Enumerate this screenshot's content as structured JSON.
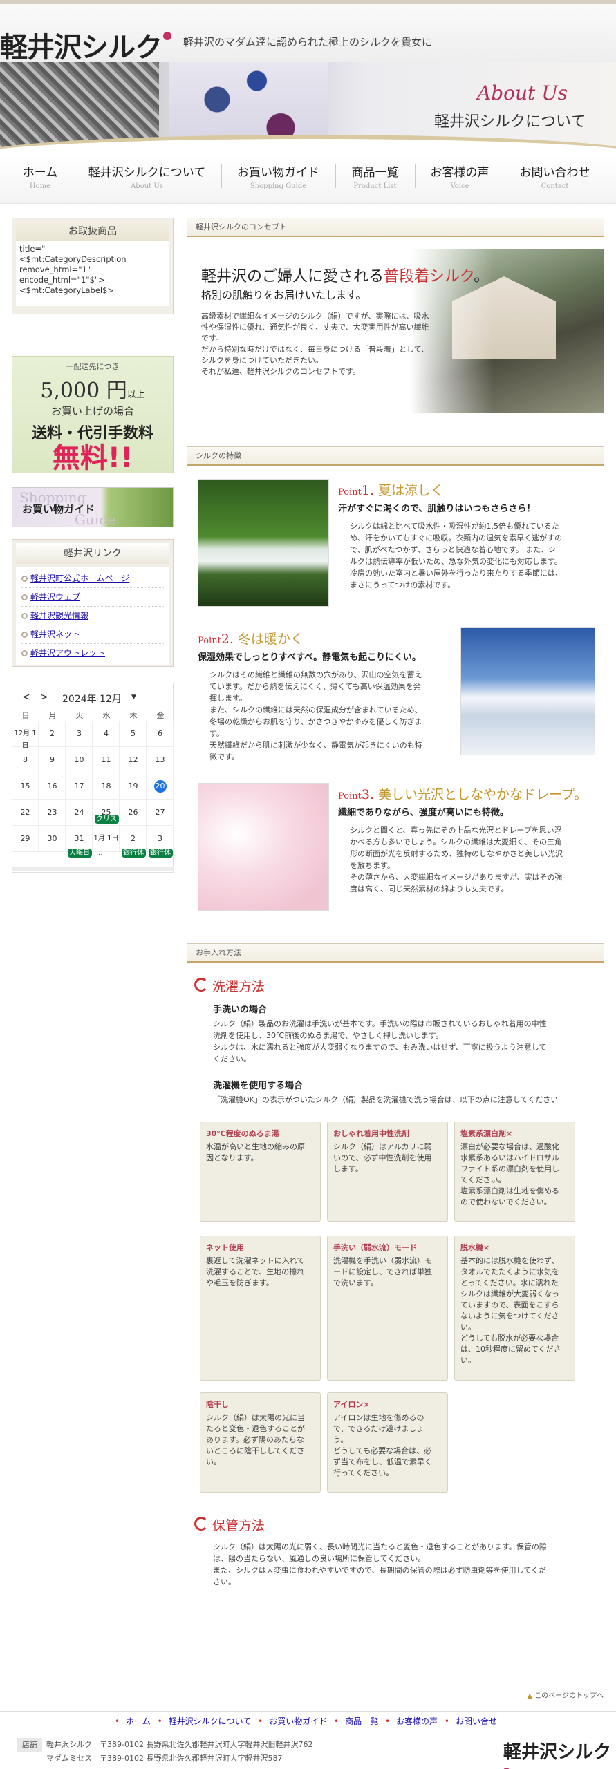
{
  "header": {
    "logo": "軽井沢シルク",
    "tagline": "軽井沢のマダム達に認められた極上のシルクを貴女に"
  },
  "banner": {
    "script": "About Us",
    "title": "軽井沢シルクについて"
  },
  "gnav": [
    {
      "jp": "ホーム",
      "en": "Home"
    },
    {
      "jp": "軽井沢シルクについて",
      "en": "About Us"
    },
    {
      "jp": "お買い物ガイド",
      "en": "Shopping Guide"
    },
    {
      "jp": "商品一覧",
      "en": "Product List"
    },
    {
      "jp": "お客様の声",
      "en": "Voice"
    },
    {
      "jp": "お問い合わせ",
      "en": "Contact"
    }
  ],
  "sidebar": {
    "category_title": "お取扱商品",
    "category_text": "title=\"\n<$mt:CategoryDescription remove_html=\"1\" encode_html=\"1\"$\">\n<$mt:CategoryLabel$>",
    "shipping": {
      "line1": "一配送先につき",
      "amount": "5,000 円",
      "amount_suffix": "以上",
      "line2": "お買い上げの場合",
      "line3": "送料・代引手数料",
      "line4": "無料!!"
    },
    "guide": {
      "en1": "Shopping",
      "jp": "お買い物ガイド",
      "en2": "Guide"
    },
    "links_title": "軽井沢リンク",
    "links": [
      "軽井沢町公式ホームページ",
      "軽井沢ウェブ",
      "軽井沢観光情報",
      "軽井沢ネット",
      "軽井沢アウトレット"
    ],
    "calendar": {
      "month": "2024年 12月",
      "prev": "<",
      "next": ">",
      "weekdays": [
        "日",
        "月",
        "火",
        "水",
        "木",
        "金"
      ],
      "weeks": [
        [
          "12月 1日",
          "2",
          "3",
          "4",
          "5",
          "6"
        ],
        [
          "8",
          "9",
          "10",
          "11",
          "12",
          "13"
        ],
        [
          "15",
          "16",
          "17",
          "18",
          "19",
          "20"
        ],
        [
          "22",
          "23",
          "24",
          "25",
          "26",
          "27"
        ],
        [
          "29",
          "30",
          "31",
          "1月 1日",
          "2",
          "3"
        ]
      ],
      "today": "20",
      "events": [
        "クリス",
        "大晦日",
        "...",
        "銀行休",
        "銀行休"
      ]
    }
  },
  "concept": {
    "heading": "軽井沢シルクのコンセプト",
    "title_a": "軽井沢のご婦人に愛される",
    "title_b": "普段着シルク",
    "title_c": "。",
    "sub": "格別の肌触りをお届けいたします。",
    "body": "高級素材で繊細なイメージのシルク（絹）ですが、実際には、吸水\n性や保湿性に優れ、通気性が良く、丈夫で、大変実用性が高い繊維\nです。\nだから特別な時だけではなく、毎日身につける「普段着」として、\nシルクを身につけていただきたい。\nそれが私達、軽井沢シルクのコンセプトです。"
  },
  "features": {
    "heading": "シルクの特徴",
    "items": [
      {
        "pt": "Point",
        "num": "1.",
        "title": "夏は涼しく",
        "lead": "汗がすぐに渇くので、肌触りはいつもさらさら！",
        "body": "シルクは綿と比べて吸水性・吸湿性が約1.5倍も優れているた\nめ、汗をかいてもすぐに吸収。衣類内の湿気を素早く逃がすの\nで、肌がべたつかず、さらっと快適な着心地です。 また、シ\nルクは熱伝導率が低いため、急な外気の変化にも対応します。\n冷房の効いた室内と暑い屋外を行ったり来たりする季節には、\nまさにうってつけの素材です。"
      },
      {
        "pt": "Point",
        "num": "2.",
        "title": "冬は暖かく",
        "lead": "保湿効果でしっとりすべすべ。静電気も起こりにくい。",
        "body": "シルクはその繊維と繊維の無数の穴があり、沢山の空気を蓄え\nています。だから熱を伝えにくく、薄くても高い保温効果を発\n揮します。\nまた、シルクの繊維には天然の保湿成分が含まれているため、\n冬場の乾燥からお肌を守り、かさつきやかゆみを優しく防ぎま\nす。\n天然繊維だから肌に刺激が少なく、静電気が起きにくいのも特\n徴です。"
      },
      {
        "pt": "Point",
        "num": "3.",
        "title": "美しい光沢としなやかなドレープ。",
        "lead": "繊細でありながら、強度が高いにも特徴。",
        "body": "シルクと聞くと、真っ先にその上品な光沢とドレープを思い浮\nかべる方も多いでしょう。シルクの繊維は大変細く、その三角\n形の断面が光を反射するため、独特のしなやかさと美しい光沢\nを放ちます。\nその薄さから、大変繊細なイメージがありますが、実はその強\n度は高く、同じ天然素材の綿よりも丈夫です。"
      }
    ]
  },
  "care": {
    "heading": "お手入れ方法",
    "wash_title": "洗濯方法",
    "hand_title": "手洗いの場合",
    "hand_body": "シルク（絹）製品のお洗濯は手洗いが基本です。手洗いの際は市販されているおしゃれ着用の中性\n洗剤を使用し、30℃前後のぬるま湯で、やさしく押し洗いします。\nシルクは、水に濡れると強度が大変弱くなりますので、もみ洗いはせず、丁寧に扱うよう注意して\nください。",
    "machine_title": "洗濯機を使用する場合",
    "machine_body": "「洗濯機OK」の表示がついたシルク（絹）製品を洗濯機で洗う場合は、以下の点に注意してください",
    "cards": [
      {
        "t": "30℃程度のぬるま湯",
        "d": "水温が高いと生地の縮みの原\n因となります。"
      },
      {
        "t": "おしゃれ着用中性洗剤",
        "d": "シルク（絹）はアルカリに弱\nいので、必ず中性洗剤を使用\nします。"
      },
      {
        "t": "塩素系漂白剤×",
        "d": "漂白が必要な場合は、過酸化\n水素系あるいはハイドロサル\nファイト系の漂白剤を使用し\nてください。\n塩素系漂白剤は生地を傷める\nので使わないでください。"
      },
      {
        "t": "ネット使用",
        "d": "裏返して洗濯ネットに入れて\n洗濯することで、生地の擦れ\nや毛玉を防ぎます。"
      },
      {
        "t": "手洗い（弱水流）モード",
        "d": "洗濯機を手洗い（弱水流）モ\nードに設定し、できれば単独\nで洗います。"
      },
      {
        "t": "脱水機×",
        "d": "基本的には脱水機を使わず、\nタオルでたたくように水気を\nとってください。水に濡れた\nシルクは繊維が大変弱くなっ\nていますので、表面をこすら\nないように気をつけてくださ\nい。\nどうしても脱水が必要な場合\nは、10秒程度に留めてくださ\nい。"
      },
      {
        "t": "陰干し",
        "d": "シルク（絹）は太陽の光に当\nたると変色・退色することが\nあります。必ず陽のあたらな\nいところに陰干ししてくださ\nい。"
      },
      {
        "t": "アイロン×",
        "d": "アイロンは生地を傷めるの\nで、できるだけ避けましょ\nう。\nどうしても必要な場合は、必\nず当て布をし、低温で素早く\n行ってください。"
      }
    ],
    "storage_title": "保管方法",
    "storage_body": "シルク（絹）は太陽の光に弱く、長い時間光に当たると変色・退色することがあります。保管の際\nは、陽の当たらない、風通しの良い場所に保管してください。\nまた、シルクは大変虫に食われやすいですので、長期間の保管の際は必ず防虫剤等を使用してくだ\nさい。"
  },
  "footer": {
    "pagetop": "このページのトップへ",
    "nav": [
      "ホーム",
      "軽井沢シルクについて",
      "お買い物ガイド",
      "商品一覧",
      "お客様の声",
      "お問い合せ"
    ],
    "label": "店舗",
    "line1": "軽井沢シルク　〒389-0102 長野県北佐久郡軽井沢町大字軽井沢旧軽井沢762",
    "line2": "マダムミセス　〒389-0102 長野県北佐久郡軽井沢町大字軽井沢587",
    "logo": "軽井沢シルク"
  }
}
